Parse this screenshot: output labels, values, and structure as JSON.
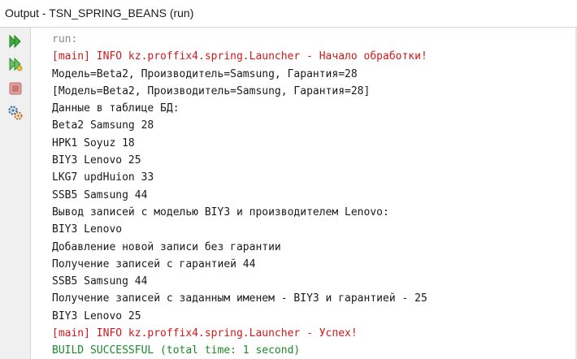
{
  "window": {
    "title": "Output - TSN_SPRING_BEANS (run)"
  },
  "gutter": {
    "icons": [
      "rerun-icon",
      "rerun-with-options-icon",
      "stop-icon",
      "settings-icon"
    ]
  },
  "colors": {
    "error_red": "#d11a1a",
    "success_green": "#1b8a2a",
    "faint_gray": "#8a8a8a"
  },
  "console": {
    "lines": [
      {
        "text": "run:",
        "style": "faint"
      },
      {
        "text": "[main] INFO kz.proffix4.spring.Launcher - Начало обработки!",
        "style": "red"
      },
      {
        "text": "Модель=Beta2, Производитель=Samsung, Гарантия=28",
        "style": "normal"
      },
      {
        "text": "[Модель=Beta2, Производитель=Samsung, Гарантия=28]",
        "style": "normal"
      },
      {
        "text": "Данные в таблице БД:",
        "style": "normal"
      },
      {
        "text": "Beta2 Samsung 28",
        "style": "normal"
      },
      {
        "text": "HPK1 Soyuz 18",
        "style": "normal"
      },
      {
        "text": "BIY3 Lenovo 25",
        "style": "normal"
      },
      {
        "text": "LKG7 updHuion 33",
        "style": "normal"
      },
      {
        "text": "SSB5 Samsung 44",
        "style": "normal"
      },
      {
        "text": "Вывод записей с моделью BIY3 и производителем Lenovo:",
        "style": "normal"
      },
      {
        "text": "BIY3 Lenovo",
        "style": "normal"
      },
      {
        "text": "Добавление новой записи без гарантии",
        "style": "normal"
      },
      {
        "text": "Получение записей с гарантией 44",
        "style": "normal"
      },
      {
        "text": "SSB5 Samsung 44",
        "style": "normal"
      },
      {
        "text": "Получение записей с заданным именем - BIY3 и гарантией - 25",
        "style": "normal"
      },
      {
        "text": "BIY3 Lenovo 25",
        "style": "normal"
      },
      {
        "text": "[main] INFO kz.proffix4.spring.Launcher - Успех!",
        "style": "red"
      },
      {
        "text": "BUILD SUCCESSFUL (total time: 1 second)",
        "style": "green"
      }
    ]
  }
}
